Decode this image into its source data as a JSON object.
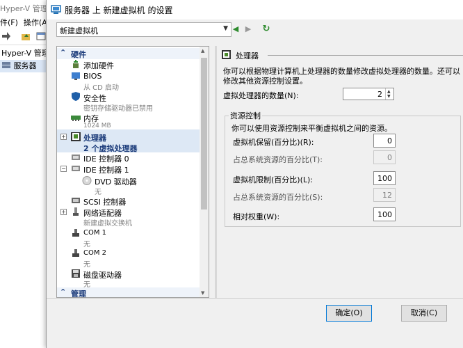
{
  "background_window": {
    "title": "Hyper-V 管理",
    "menu": [
      "件(F)",
      "操作(A)"
    ],
    "tree": [
      "Hyper-V 管理",
      "服务器"
    ]
  },
  "dialog": {
    "title": "服务器 上 新建虚拟机 的设置",
    "vm_select_value": "新建虚拟机"
  },
  "hardware_section": {
    "label": "硬件"
  },
  "management_section": {
    "label": "管理"
  },
  "tree_items": [
    {
      "name": "添加硬件",
      "sub": ""
    },
    {
      "name": "BIOS",
      "sub": "从 CD 启动"
    },
    {
      "name": "安全性",
      "sub": "密钥存储驱动器已禁用"
    },
    {
      "name": "内存",
      "sub": "1024 MB"
    },
    {
      "name": "处理器",
      "sub": "2 个虚拟处理器"
    },
    {
      "name": "IDE 控制器 0",
      "sub": ""
    },
    {
      "name": "IDE 控制器 1",
      "sub": ""
    },
    {
      "name": "DVD 驱动器",
      "sub": "无"
    },
    {
      "name": "SCSI 控制器",
      "sub": ""
    },
    {
      "name": "网络适配器",
      "sub": "新建虚拟交换机"
    },
    {
      "name": "COM 1",
      "sub": "无"
    },
    {
      "name": "COM 2",
      "sub": "无"
    },
    {
      "name": "磁盘驱动器",
      "sub": "无"
    }
  ],
  "processor_panel": {
    "title": "处理器",
    "description": "你可以根据物理计算机上处理器的数量修改虚拟处理器的数量。还可以修改其他资源控制设置。",
    "vcpu_label": "虚拟处理器的数量(N):",
    "vcpu_value": "2",
    "resource_group_title": "资源控制",
    "resource_desc": "你可以使用资源控制来平衡虚拟机之间的资源。",
    "fields": [
      {
        "label": "虚拟机保留(百分比)(R):",
        "value": "0",
        "disabled": false
      },
      {
        "label": "占总系统资源的百分比(T):",
        "value": "0",
        "disabled": true
      },
      {
        "label": "虚拟机限制(百分比)(L):",
        "value": "100",
        "disabled": false
      },
      {
        "label": "占总系统资源的百分比(S):",
        "value": "12",
        "disabled": true
      },
      {
        "label": "相对权重(W):",
        "value": "100",
        "disabled": false
      }
    ]
  },
  "buttons": {
    "ok": "确定(O)",
    "cancel": "取消(C)"
  }
}
